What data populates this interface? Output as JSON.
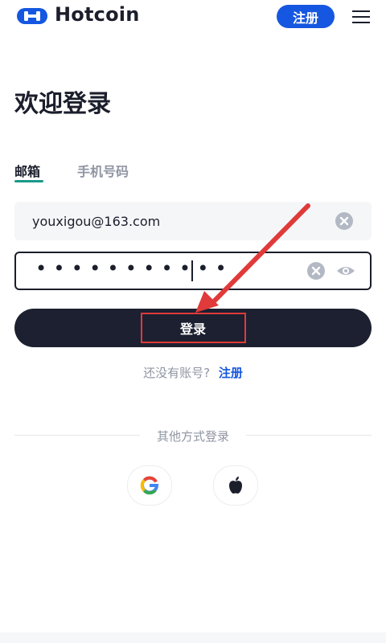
{
  "header": {
    "logo_text": "Hotcoin",
    "register_label": "注册"
  },
  "page": {
    "title": "欢迎登录"
  },
  "tabs": [
    {
      "label": "邮箱",
      "active": true
    },
    {
      "label": "手机号码",
      "active": false
    }
  ],
  "form": {
    "email_value": "youxigou@163.com",
    "password_masked": "•••••••••••",
    "login_label": "登录"
  },
  "footer": {
    "no_account_text": "还没有账号?",
    "register_link": "注册",
    "other_login_label": "其他方式登录"
  },
  "colors": {
    "brand_blue": "#1557e0",
    "button_dark": "#1c2030",
    "tab_accent": "#1a9a8a",
    "annotation_red": "#e03a3a"
  },
  "icons": [
    "logo-icon",
    "menu-icon",
    "clear-icon",
    "eye-icon",
    "google-icon",
    "apple-icon"
  ]
}
